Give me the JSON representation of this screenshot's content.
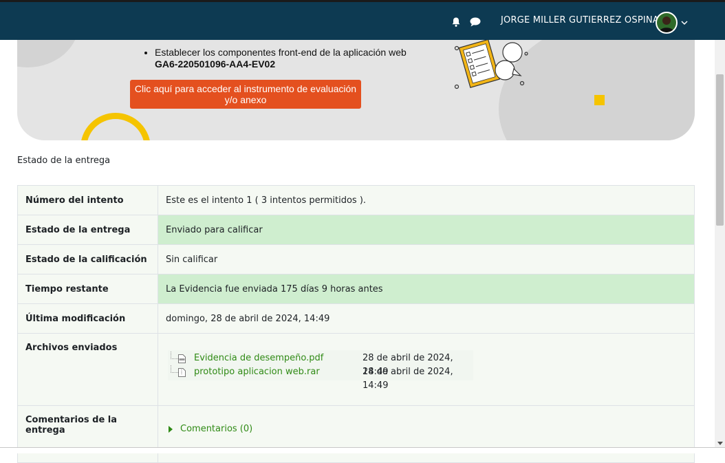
{
  "header": {
    "username": "JORGE MILLER GUTIERREZ OSPINA",
    "icons": [
      "bell-icon",
      "chat-icon",
      "avatar",
      "chevron-down-icon"
    ],
    "bar_color": "#0d3a52"
  },
  "banner": {
    "bullet_text": "Establecer los componentes front-end de la aplicación web",
    "evidence_code": "GA6-220501096-AA4-EV02",
    "cta_label": "Clic aquí para acceder al instrumento de evaluación y/o anexo",
    "cta_color": "#e4501f",
    "accent_color": "#f5c400"
  },
  "section_label": "Estado de la entrega",
  "status_table": {
    "rows": [
      {
        "label": "Número del intento",
        "value": "Este es el intento 1 ( 3 intentos permitidos )."
      },
      {
        "label": "Estado de la entrega",
        "value": "Enviado para calificar"
      },
      {
        "label": "Estado de la calificación",
        "value": "Sin calificar"
      },
      {
        "label": "Tiempo restante",
        "value": "La Evidencia fue enviada 175 días 9 horas antes"
      },
      {
        "label": "Última modificación",
        "value": "domingo, 28 de abril de 2024, 14:49"
      }
    ],
    "files_label": "Archivos enviados",
    "files": [
      {
        "name": "Evidencia de desempeño.pdf",
        "date": "28 de abril de 2024, 14:49",
        "icon": "pdf-file-icon"
      },
      {
        "name": "prototipo aplicacion web.rar",
        "date": "28 de abril de 2024, 14:49",
        "icon": "archive-file-icon"
      }
    ],
    "comments_label": "Comentarios de la entrega",
    "comments_link": "Comentarios (0)",
    "highlight_color": "#cfeecf",
    "link_color": "#2f8a15"
  }
}
